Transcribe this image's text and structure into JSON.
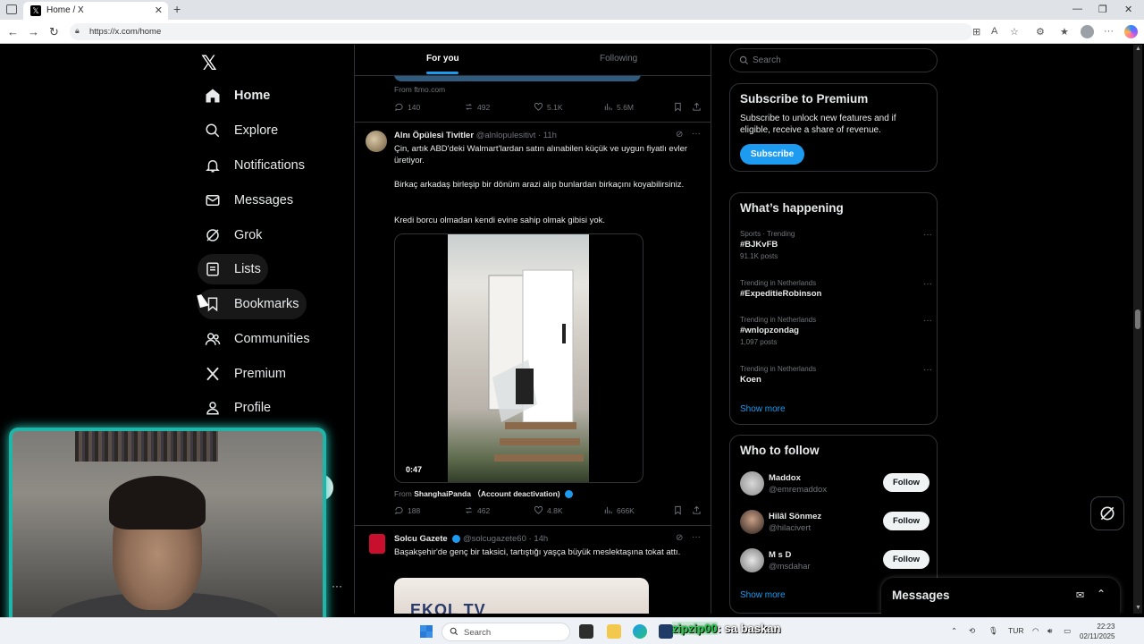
{
  "browser": {
    "tab_title": "Home / X",
    "url": "https://x.com/home"
  },
  "sidebar": {
    "items": [
      {
        "label": "Home",
        "icon": "home-icon"
      },
      {
        "label": "Explore",
        "icon": "search-icon"
      },
      {
        "label": "Notifications",
        "icon": "bell-icon"
      },
      {
        "label": "Messages",
        "icon": "envelope-icon"
      },
      {
        "label": "Grok",
        "icon": "grok-icon"
      },
      {
        "label": "Lists",
        "icon": "list-icon"
      },
      {
        "label": "Bookmarks",
        "icon": "bookmark-icon"
      },
      {
        "label": "Communities",
        "icon": "people-icon"
      },
      {
        "label": "Premium",
        "icon": "x-icon"
      },
      {
        "label": "Profile",
        "icon": "person-icon"
      }
    ]
  },
  "feed": {
    "tabs": [
      "For you",
      "Following"
    ],
    "prev_post": {
      "from": "From ftmo.com",
      "replies": "140",
      "reposts": "492",
      "likes": "5.1K",
      "views": "5.6M"
    },
    "post1": {
      "name": "Alnı Öpülesi Tivitler",
      "handle": "@alnlopulesitivt",
      "time": "· 11h",
      "text1": "Çin, artık ABD'deki Walmart'lardan satın alınabilen küçük ve uygun fiyatlı evler üretiyor.",
      "text2": "Birkaç arkadaş birleşip bir dönüm arazi alıp bunlardan birkaçını koyabilirsiniz.",
      "text3": "Kredi borcu olmadan kendi evine sahip olmak gibisi yok.",
      "duration": "0:47",
      "from_prefix": "From",
      "from_account": "ShanghaiPanda （Account deactivation)",
      "replies": "188",
      "reposts": "462",
      "likes": "4.8K",
      "views": "666K"
    },
    "post2": {
      "name": "Solcu Gazete",
      "handle": "@solcugazete60",
      "time": "· 14h",
      "text": "Başakşehir'de genç bir taksici, tartıştığı yaşça büyük meslektaşına tokat attı.",
      "media_logo": "EKOL TV"
    }
  },
  "right": {
    "search_placeholder": "Search",
    "premium": {
      "title": "Subscribe to Premium",
      "desc": "Subscribe to unlock new features and if eligible, receive a share of revenue.",
      "button": "Subscribe"
    },
    "happening": {
      "title": "What’s happening",
      "trends": [
        {
          "cat": "Sports · Trending",
          "tag": "#BJKvFB",
          "count": "91.1K posts"
        },
        {
          "cat": "Trending in Netherlands",
          "tag": "#ExpeditieRobinson",
          "count": ""
        },
        {
          "cat": "Trending in Netherlands",
          "tag": "#wnlopzondag",
          "count": "1,097 posts"
        },
        {
          "cat": "Trending in Netherlands",
          "tag": "Koen",
          "count": ""
        }
      ],
      "show_more": "Show more"
    },
    "who_to_follow": {
      "title": "Who to follow",
      "users": [
        {
          "name": "Maddox",
          "handle": "@emremaddox",
          "button": "Follow"
        },
        {
          "name": "Hilâl Sönmez",
          "handle": "@hilacivert",
          "button": "Follow"
        },
        {
          "name": "M s D",
          "handle": "@msdahar",
          "button": "Follow"
        }
      ],
      "show_more": "Show more"
    },
    "messages_drawer": "Messages"
  },
  "taskbar": {
    "search_placeholder": "Search",
    "chat_user": "zipzip00",
    "chat_message": ": sa baskan",
    "lang": "TUR",
    "time": "22:23",
    "date": "02/11/2025"
  }
}
